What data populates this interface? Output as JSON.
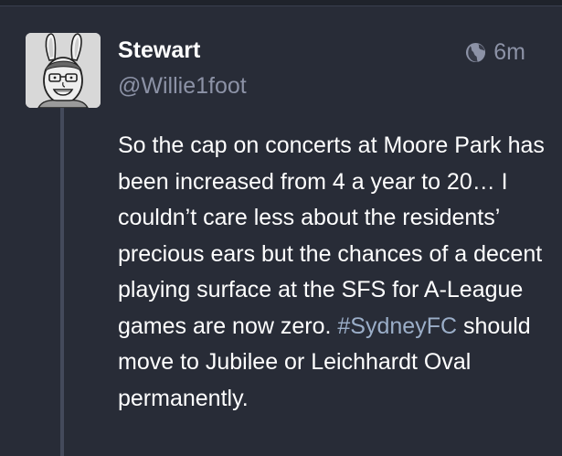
{
  "account": {
    "display_name": "Stewart",
    "handle": "@Willie1foot",
    "avatar_icon": "bunny-ears-cartoon-avatar"
  },
  "status": {
    "visibility_icon": "globe-icon",
    "relative_time": "6m",
    "text_before": "So the cap on concerts at Moore Park has been increased from 4 a year to 20… I couldn’t care less about the residents’ precious ears but the chances of a decent playing surface at the SFS for A-League games are now zero. ",
    "hashtag": "#SydneyFC",
    "text_after": " should move to Jubilee or Leichhardt Oval permanently."
  },
  "colors": {
    "background": "#282c37",
    "text": "#ffffff",
    "muted": "#8c92a6",
    "hashtag": "#9baec8",
    "thread_line": "#444a5b"
  }
}
